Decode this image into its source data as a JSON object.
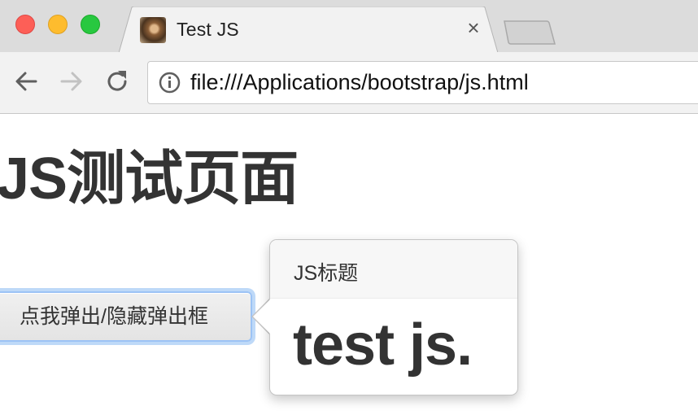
{
  "browser": {
    "tab": {
      "title": "Test JS",
      "favicon": "monkey-favicon-icon",
      "close_icon": "close-icon",
      "close_glyph": "×"
    },
    "toolbar": {
      "back_icon": "back-arrow-icon",
      "forward_icon": "forward-arrow-icon",
      "reload_icon": "reload-icon",
      "info_icon": "info-icon",
      "url": "file:///Applications/bootstrap/js.html"
    }
  },
  "page": {
    "heading": "JS测试页面",
    "toggle_button_label": "点我弹出/隐藏弹出框",
    "popover": {
      "title": "JS标题",
      "content": "test js."
    }
  },
  "colors": {
    "traffic_red": "#fd5f57",
    "traffic_yellow": "#febc2e",
    "traffic_green": "#28c840",
    "button_focus_ring": "#9cc3f5",
    "text": "#333333"
  }
}
